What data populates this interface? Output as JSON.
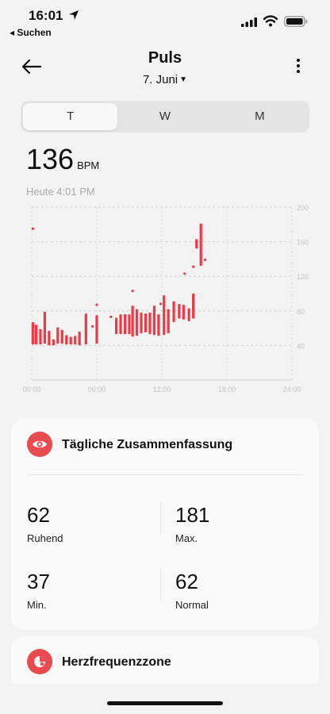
{
  "status_bar": {
    "time": "16:01",
    "back_app": "◂ Suchen"
  },
  "header": {
    "title": "Puls",
    "date": "7. Juni"
  },
  "tabs": [
    {
      "label": "T",
      "active": true
    },
    {
      "label": "W",
      "active": false
    },
    {
      "label": "M",
      "active": false
    }
  ],
  "reading": {
    "value": "136",
    "unit": "BPM",
    "time": "Heute 4:01 PM"
  },
  "colors": {
    "accent": "#e94b4f",
    "bar": "#ec3b47"
  },
  "chart_data": {
    "type": "bar",
    "x_unit": "hour of day",
    "xlim": [
      0,
      24
    ],
    "ylim": [
      0,
      200
    ],
    "y_ticks": [
      "200",
      "160",
      "120",
      "80",
      "40"
    ],
    "x_ticks": [
      "00:00",
      "06:00",
      "12:00",
      "18:00",
      "24:00"
    ],
    "grid": true,
    "ranges": [
      {
        "x": 0.1,
        "lo": 41,
        "hi": 67
      },
      {
        "x": 0.4,
        "lo": 41,
        "hi": 64
      },
      {
        "x": 0.8,
        "lo": 41,
        "hi": 59
      },
      {
        "x": 1.2,
        "lo": 42,
        "hi": 79
      },
      {
        "x": 1.6,
        "lo": 40,
        "hi": 57
      },
      {
        "x": 2.0,
        "lo": 40,
        "hi": 47
      },
      {
        "x": 2.4,
        "lo": 42,
        "hi": 61
      },
      {
        "x": 2.8,
        "lo": 42,
        "hi": 58
      },
      {
        "x": 3.2,
        "lo": 41,
        "hi": 52
      },
      {
        "x": 3.6,
        "lo": 41,
        "hi": 50
      },
      {
        "x": 4.0,
        "lo": 41,
        "hi": 51
      },
      {
        "x": 4.4,
        "lo": 40,
        "hi": 56
      },
      {
        "x": 5.0,
        "lo": 41,
        "hi": 77
      },
      {
        "x": 6.0,
        "lo": 42,
        "hi": 75
      },
      {
        "x": 7.8,
        "lo": 53,
        "hi": 72
      },
      {
        "x": 8.2,
        "lo": 53,
        "hi": 76
      },
      {
        "x": 8.6,
        "lo": 53,
        "hi": 76
      },
      {
        "x": 9.0,
        "lo": 53,
        "hi": 76
      },
      {
        "x": 9.3,
        "lo": 50,
        "hi": 86
      },
      {
        "x": 9.7,
        "lo": 51,
        "hi": 82
      },
      {
        "x": 10.1,
        "lo": 54,
        "hi": 78
      },
      {
        "x": 10.5,
        "lo": 55,
        "hi": 77
      },
      {
        "x": 10.9,
        "lo": 53,
        "hi": 78
      },
      {
        "x": 11.3,
        "lo": 52,
        "hi": 86
      },
      {
        "x": 11.7,
        "lo": 51,
        "hi": 76
      },
      {
        "x": 12.2,
        "lo": 52,
        "hi": 98
      },
      {
        "x": 12.6,
        "lo": 54,
        "hi": 82
      },
      {
        "x": 13.1,
        "lo": 67,
        "hi": 91
      },
      {
        "x": 13.6,
        "lo": 71,
        "hi": 88
      },
      {
        "x": 14.0,
        "lo": 70,
        "hi": 87
      },
      {
        "x": 14.5,
        "lo": 68,
        "hi": 83
      },
      {
        "x": 14.9,
        "lo": 71,
        "hi": 100
      },
      {
        "x": 15.2,
        "lo": 152,
        "hi": 163
      },
      {
        "x": 15.6,
        "lo": 132,
        "hi": 181
      }
    ],
    "points": [
      {
        "x": 0.1,
        "y": 175
      },
      {
        "x": 5.6,
        "y": 62
      },
      {
        "x": 6.0,
        "y": 87
      },
      {
        "x": 7.3,
        "y": 73
      },
      {
        "x": 9.3,
        "y": 103
      },
      {
        "x": 11.9,
        "y": 88
      },
      {
        "x": 14.1,
        "y": 123
      },
      {
        "x": 14.9,
        "y": 131
      },
      {
        "x": 16.0,
        "y": 139
      }
    ]
  },
  "summary": {
    "title": "Tägliche Zusammenfassung",
    "stats": [
      {
        "value": "62",
        "label": "Ruhend"
      },
      {
        "value": "181",
        "label": "Max."
      },
      {
        "value": "37",
        "label": "Min."
      },
      {
        "value": "62",
        "label": "Normal"
      }
    ]
  },
  "zone": {
    "title": "Herzfrequenzzone"
  }
}
